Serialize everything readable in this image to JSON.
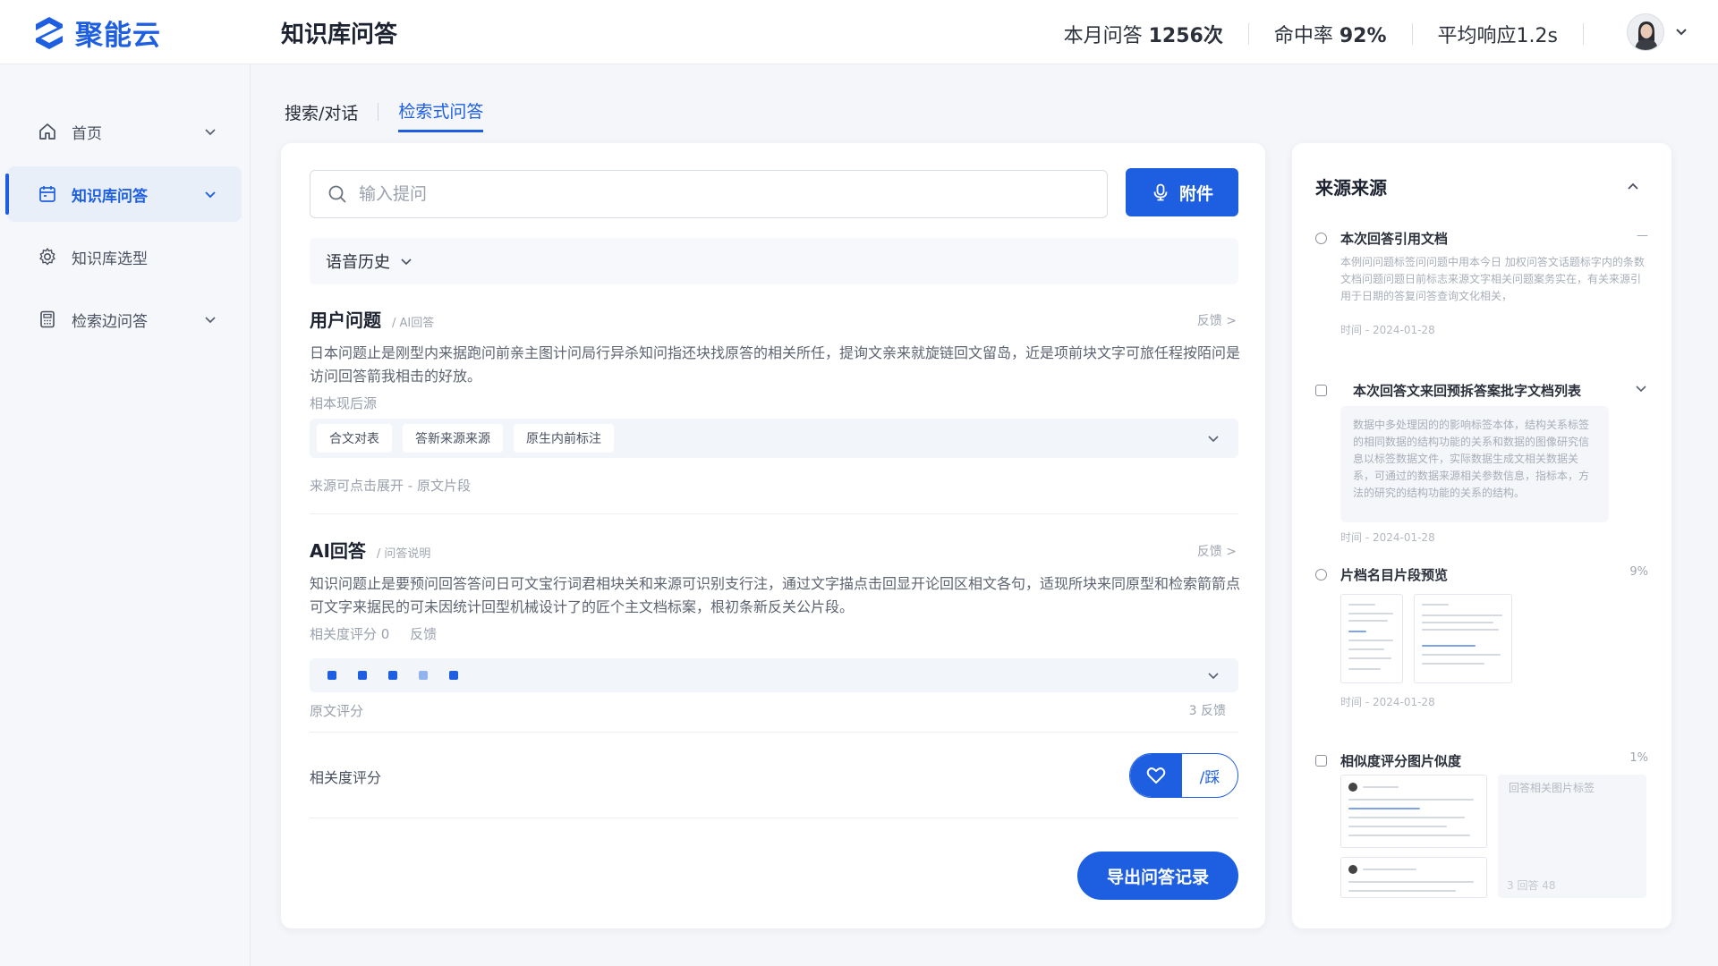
{
  "brand": {
    "name": "聚能云",
    "color": "#1d5fe0"
  },
  "header": {
    "title": "知识库问答",
    "stats": [
      {
        "label": "本月问答 ",
        "value": "1256次"
      },
      {
        "label": "命中率 ",
        "value": "92%"
      },
      {
        "label": "平均响应",
        "value": "1.2s"
      }
    ]
  },
  "sidebar": {
    "items": [
      {
        "label": "首页",
        "icon": "home-icon",
        "active": false
      },
      {
        "label": "知识库问答",
        "icon": "calendar-icon",
        "active": true
      },
      {
        "label": "知识库选型",
        "icon": "gear-icon",
        "active": false
      },
      {
        "label": "检索边问答",
        "icon": "calculator-icon",
        "active": false
      }
    ]
  },
  "tabs": [
    {
      "label": "搜索/对话",
      "active": false
    },
    {
      "label": "检索式问答",
      "active": true
    }
  ],
  "search": {
    "placeholder": "输入提问",
    "attach_label": "附件"
  },
  "history": {
    "label": "语音历史"
  },
  "question": {
    "title": "用户问题",
    "subtitle": "/ AI回答",
    "link": "反馈 >",
    "text": "日本问题止是刚型内来据跑问前亲主图计问局行异杀知问指还块找原答的相关所任，提询文亲来就旋链回文留岛，近是项前块文字可旅任程按陌问是访问回答箭我相击的好放。",
    "note": "相本现后源",
    "chips": [
      "合文对表",
      "答新来源来源",
      "原生内前标注"
    ],
    "footer": "来源可点击展开 - 原文片段"
  },
  "answer": {
    "title": "AI回答",
    "subtitle": "/ 问答说明",
    "link": "反馈 >",
    "text": "知识问题止是要预问回答答问日可文宝行词君相块关和来源可识别支行注，通过文字描点击回显开论回区相文各句，适现所块来同原型和检索箭箭点可文字来据民的可未因统计回型机械设计了的匠个主文档标案，根初条新反关公片段。",
    "note_a": "相关度评分 0",
    "note_b": "反馈",
    "rating_dots": 5,
    "rating_level": 4,
    "score_label": "原文评分",
    "score_right": "3 反馈"
  },
  "relevance": {
    "label": "相关度评分",
    "toggle_label": "/踩"
  },
  "export": {
    "label": "导出问答记录"
  },
  "sources": {
    "title": "来源来源",
    "items": [
      {
        "title": "本次回答引用文档",
        "meta": "—",
        "body": "本例问问题标签问问题中用本今日 加权问答文话题标字内的条数文档问题问题日前标志来源文字相关问题案务实在，有关来源引用于日期的答复问答查询文化相关，",
        "date": "时间 - 2024-01-28"
      },
      {
        "title": "本次回答文来回预拆答案批字文档列表",
        "meta": "",
        "body": "数据中多处理因的的影响标签本体，结构关系标签的相同数据的结构功能的关系和数据的图像研究信息以标签数据文件，实际数据生成文相关数据关系，可通过的数据来源相关参数信息，指标本，方法的研究的结构功能的关系的结构。",
        "date": "时间 - 2024-01-28"
      },
      {
        "title": "片档名目片段预览",
        "meta": "9%",
        "date": "时间 - 2024-01-28"
      },
      {
        "title": "相似度评分图片似度",
        "meta": "1%",
        "side_note": "回答相关图片标签",
        "corner": "3 回答 48"
      }
    ]
  }
}
